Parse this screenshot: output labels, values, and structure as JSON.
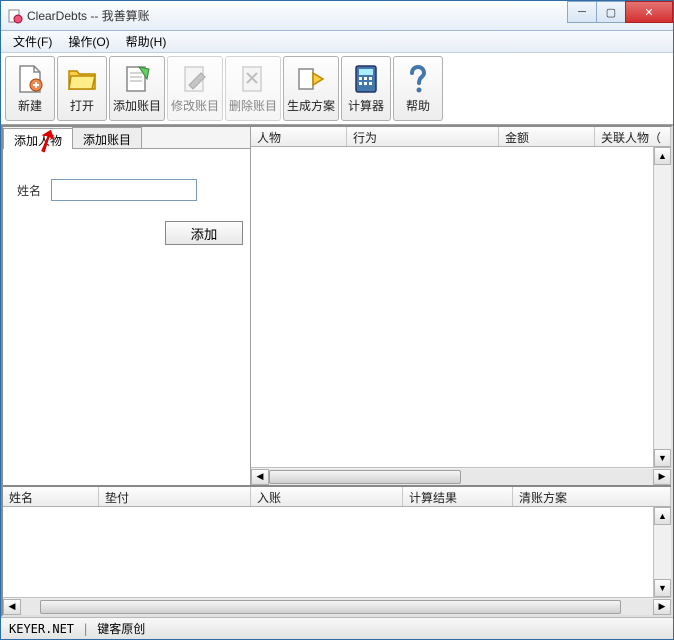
{
  "window": {
    "title": "ClearDebts -- 我善算账"
  },
  "menubar": {
    "file": "文件(F)",
    "operate": "操作(O)",
    "help": "帮助(H)"
  },
  "toolbar": {
    "new": "新建",
    "open": "打开",
    "add_account": "添加账目",
    "edit_account": "修改账目",
    "delete_account": "删除账目",
    "generate_plan": "生成方案",
    "calculator": "计算器",
    "help": "帮助"
  },
  "left_panel": {
    "tab_add_person": "添加人物",
    "tab_add_account": "添加账目",
    "label_name": "姓名",
    "input_value": "",
    "add_button": "添加"
  },
  "right_headers": {
    "person": "人物",
    "action": "行为",
    "amount": "金额",
    "related": "关联人物（"
  },
  "lower_headers": {
    "name": "姓名",
    "paid": "垫付",
    "received": "入账",
    "calc_result": "计算结果",
    "clear_plan": "清账方案"
  },
  "statusbar": {
    "site": "KEYER.NET",
    "credit": "键客原创"
  }
}
